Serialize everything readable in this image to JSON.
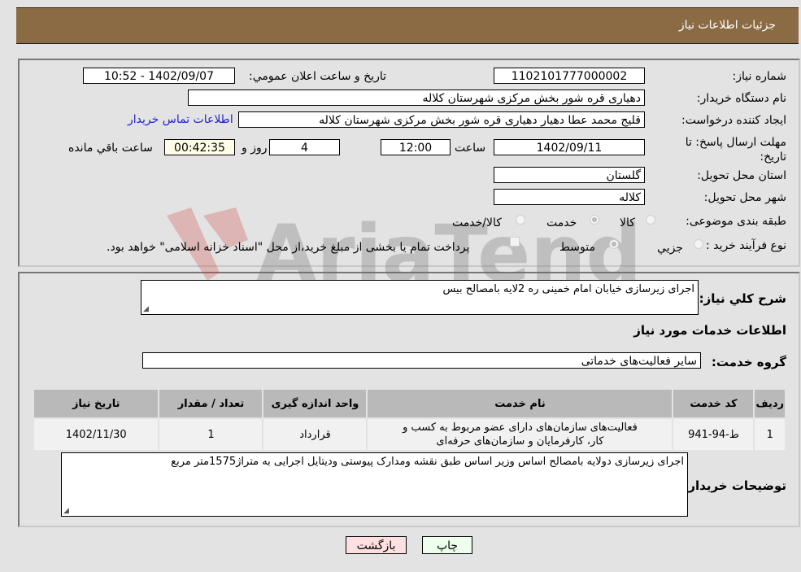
{
  "header": {
    "title": "جزئیات اطلاعات نیاز"
  },
  "form": {
    "need_number": {
      "label": "شماره نیاز:",
      "value": "1102101777000002"
    },
    "announce_datetime": {
      "label": "تاریخ و ساعت اعلان عمومي:",
      "value": "1402/09/07 - 10:52"
    },
    "buyer_org": {
      "label": "نام دستگاه خريدار:",
      "value": "دهیاری قره شور بخش مرکزی شهرستان کلاله"
    },
    "requester": {
      "label": "ایجاد کننده درخواست:",
      "value": "قلیج محمد عطا دهیار دهیاری قره شور بخش مرکزی شهرستان کلاله"
    },
    "buyer_contact_link": "اطلاعات تماس خریدار",
    "deadline": {
      "label": "مهلت ارسال پاسخ: تا تاریخ:",
      "date": "1402/09/11",
      "time_label": "ساعت",
      "time": "12:00",
      "days": "4",
      "days_label": "روز و",
      "remaining": "00:42:35",
      "remaining_label": "ساعت باقي مانده"
    },
    "province": {
      "label": "استان محل تحویل:",
      "value": "گلستان"
    },
    "city": {
      "label": "شهر محل تحویل:",
      "value": "کلاله"
    },
    "category": {
      "label": "طبقه بندی موضوعی:",
      "options": [
        "کالا",
        "خدمت",
        "کالا/خدمت"
      ],
      "selected": "خدمت"
    },
    "purchase_type": {
      "label": "نوع فرآیند خرید :",
      "options": [
        "جزيي",
        "متوسط"
      ],
      "selected": "متوسط",
      "treasury_note": "پرداخت تمام یا بخشی از مبلغ خرید،از محل \"اسناد خزانه اسلامی\" خواهد بود."
    }
  },
  "details": {
    "general_desc_label": "شرح كلي نياز:",
    "general_desc": "اجرای زیرسازی خیابان امام خمینی ره 2لایه بامصالح بیس",
    "services_heading": "اطلاعات خدمات مورد نیاز",
    "service_group_label": "گروه خدمت:",
    "service_group": "سایر فعالیت‌های خدماتی",
    "table": {
      "headers": [
        "رديف",
        "کد خدمت",
        "نام خدمت",
        "واحد اندازه گیری",
        "تعداد / مقدار",
        "تاریخ نیاز"
      ],
      "rows": [
        [
          "1",
          "ط-94-941",
          "فعالیت‌های سازمان‌های دارای عضو مربوط به کسب و کار، کارفرمایان و سازمان‌های حرفه‌ای",
          "قرارداد",
          "1",
          "1402/11/30"
        ]
      ]
    },
    "buyer_notes_label": "توضیحات خریدار:",
    "buyer_notes": "اجرای زیرسازی دولایه بامصالح اساس وزیر اساس طبق نقشه ومدارک پیوستی ودیتایل اجرایی به متراژ1575متر مربع"
  },
  "buttons": {
    "print": "چاپ",
    "back": "بازگشت"
  },
  "watermark": "AriaTender.neT",
  "colors": {
    "header_bg": "#8b6b43",
    "print_bg": "#eeffee",
    "back_bg": "#ffe0e0",
    "link": "#2222cc"
  }
}
